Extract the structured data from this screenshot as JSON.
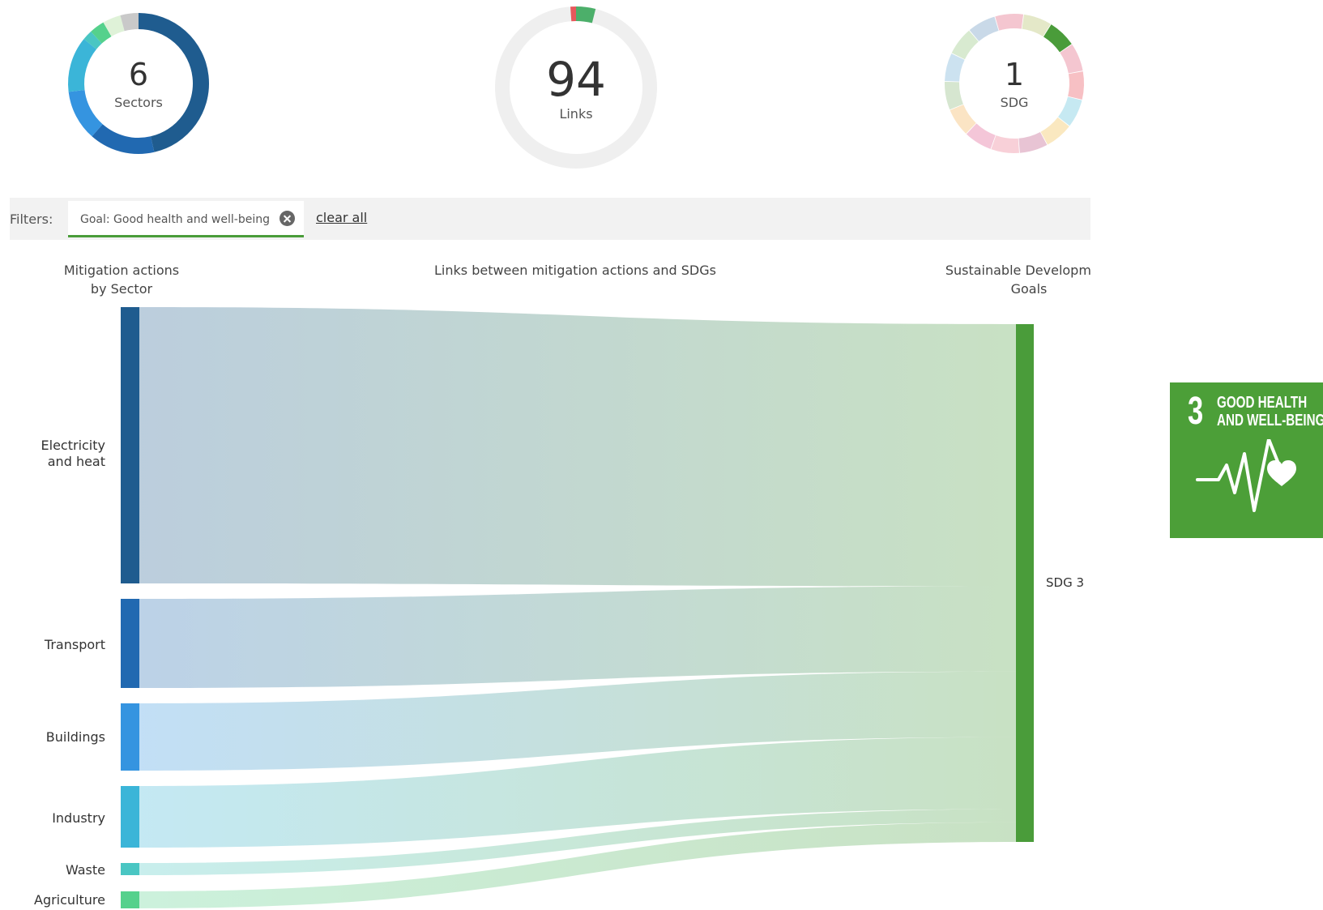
{
  "summary": {
    "sectors": {
      "value": "6",
      "label": "Sectors"
    },
    "links": {
      "value": "94",
      "label": "Links"
    },
    "sdgs": {
      "value": "1",
      "label": "SDG"
    }
  },
  "filters": {
    "label": "Filters:",
    "active": [
      {
        "label": "Goal: Good health and well-being"
      }
    ],
    "clear_all": "clear all"
  },
  "headers": {
    "left_line1": "Mitigation actions",
    "left_line2": "by Sector",
    "middle": "Links between mitigation actions and SDGs",
    "right_line1": "Sustainable Development",
    "right_line2": "Goals"
  },
  "sectors": [
    {
      "name": "Electricity and heat",
      "line1": "Electricity",
      "line2": "and heat",
      "color": "#1f5c8f",
      "links": 40
    },
    {
      "name": "Transport",
      "color": "#2169b1",
      "links": 13
    },
    {
      "name": "Buildings",
      "color": "#3594e0",
      "links": 10
    },
    {
      "name": "Industry",
      "color": "#3bb5d8",
      "links": 11
    },
    {
      "name": "Waste",
      "color": "#4ac6c3",
      "links": 2
    },
    {
      "name": "Agriculture",
      "color": "#55d18c",
      "links": 3
    }
  ],
  "sdgs": [
    {
      "name": "SDG 3",
      "color": "#4a9c3a"
    }
  ],
  "sdg_tile": {
    "number": "3",
    "title_line1": "GOOD HEALTH",
    "title_line2": "AND WELL-BEING",
    "color": "#4c9f38",
    "icon": "heartbeat-heart-icon"
  },
  "donut_colors": {
    "sectors_ring": [
      "#1f5c8f",
      "#2169b1",
      "#3594e0",
      "#3bb5d8",
      "#4ac6c3",
      "#55d18c",
      "#dff2d8",
      "#c9c9c9"
    ],
    "links_ring_track": "#efefef",
    "links_ring_accents": [
      "#e8585c",
      "#4caf6a"
    ],
    "sdg_ring": [
      "#c9d9e8",
      "#f4c6d0",
      "#e4e8c8",
      "#4a9c3a",
      "#f4c6d0",
      "#f7c0c4",
      "#c6e9f2",
      "#fae8c0",
      "#e8c4d4",
      "#f8d0d8",
      "#f4c6d8",
      "#fbe4c4",
      "#d6e6d0",
      "#cce2f0",
      "#d8ead0"
    ]
  }
}
